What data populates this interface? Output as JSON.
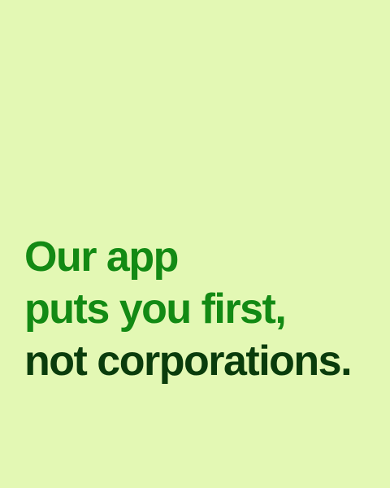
{
  "headline": {
    "line1": "Our app",
    "line2": "puts you first,",
    "line3": "not corporations."
  },
  "colors": {
    "background": "#e3f8b4",
    "accent_green": "#138a14",
    "dark_green": "#0a3c0c"
  }
}
